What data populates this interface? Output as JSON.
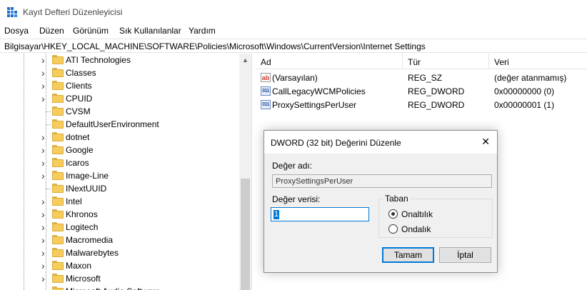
{
  "window": {
    "title": "Kayıt Defteri Düzenleyicisi",
    "icon": "registry-editor-icon"
  },
  "menu": [
    "Dosya",
    "Düzen",
    "Görünüm",
    "Sık Kullanılanlar",
    "Yardım"
  ],
  "address": "Bilgisayar\\HKEY_LOCAL_MACHINE\\SOFTWARE\\Policies\\Microsoft\\Windows\\CurrentVersion\\Internet Settings",
  "tree": {
    "items": [
      {
        "label": "ATI Technologies",
        "expandable": true
      },
      {
        "label": "Classes",
        "expandable": true
      },
      {
        "label": "Clients",
        "expandable": true
      },
      {
        "label": "CPUID",
        "expandable": true
      },
      {
        "label": "CVSM",
        "expandable": false
      },
      {
        "label": "DefaultUserEnvironment",
        "expandable": false
      },
      {
        "label": "dotnet",
        "expandable": true
      },
      {
        "label": "Google",
        "expandable": true
      },
      {
        "label": "Icaros",
        "expandable": true
      },
      {
        "label": "Image-Line",
        "expandable": true
      },
      {
        "label": "INextUUID",
        "expandable": false
      },
      {
        "label": "Intel",
        "expandable": true
      },
      {
        "label": "Khronos",
        "expandable": true
      },
      {
        "label": "Logitech",
        "expandable": true
      },
      {
        "label": "Macromedia",
        "expandable": true
      },
      {
        "label": "Malwarebytes",
        "expandable": true
      },
      {
        "label": "Maxon",
        "expandable": true
      },
      {
        "label": "Microsoft",
        "expandable": true
      },
      {
        "label": "Microsoft Audio Software",
        "expandable": true
      }
    ]
  },
  "list": {
    "headers": {
      "name": "Ad",
      "type": "Tür",
      "data": "Veri"
    },
    "rows": [
      {
        "icon": "string-value-icon",
        "name": "(Varsayılan)",
        "type": "REG_SZ",
        "data": "(değer atanmamış)"
      },
      {
        "icon": "dword-value-icon",
        "name": "CallLegacyWCMPolicies",
        "type": "REG_DWORD",
        "data": "0x00000000 (0)"
      },
      {
        "icon": "dword-value-icon",
        "name": "ProxySettingsPerUser",
        "type": "REG_DWORD",
        "data": "0x00000001 (1)"
      }
    ]
  },
  "dialog": {
    "title": "DWORD (32 bit) Değerini Düzenle",
    "close": "✕",
    "name_label": "Değer adı:",
    "name_value": "ProxySettingsPerUser",
    "value_label": "Değer verisi:",
    "value": "1",
    "base": {
      "title": "Taban",
      "options": [
        {
          "label": "Onaltılık",
          "selected": true
        },
        {
          "label": "Ondalık",
          "selected": false
        }
      ]
    },
    "ok_label": "Tamam",
    "cancel_label": "İptal"
  },
  "colors": {
    "accent": "#0078d7",
    "folder": "#f6cd5c"
  }
}
